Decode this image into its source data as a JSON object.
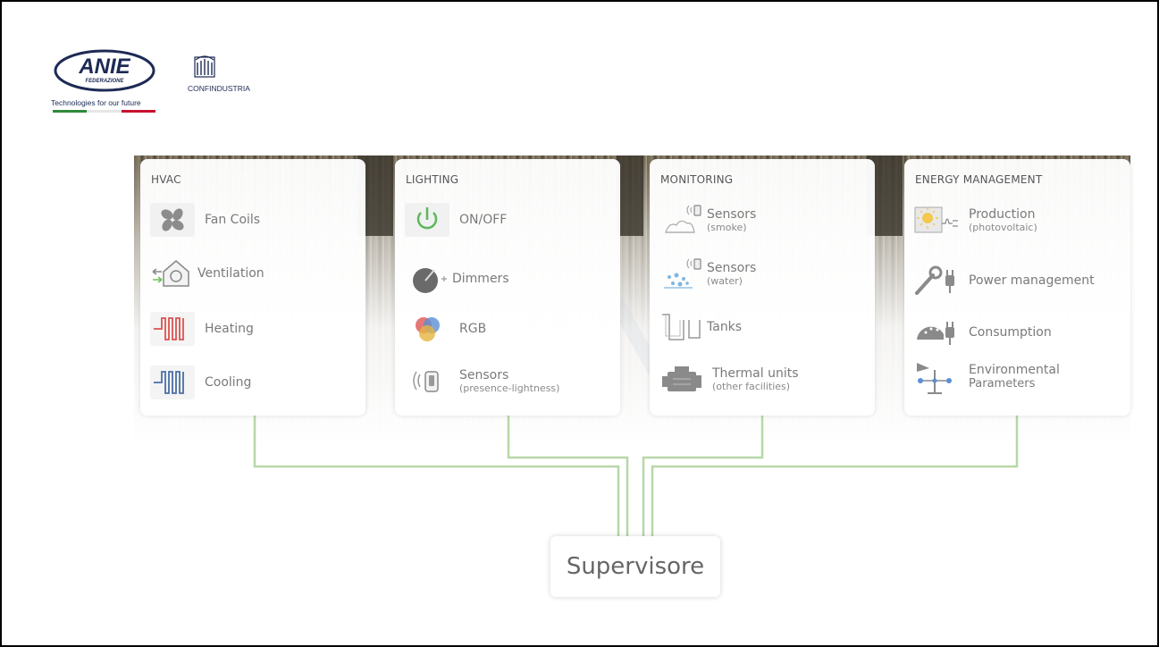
{
  "brand": {
    "anie_logo_text": "ANIE",
    "anie_logo_subtext": "FEDERAZIONE",
    "tagline": "Technologies for our future",
    "partner": "CONFINDUSTRIA"
  },
  "cards": [
    {
      "title": "HVAC",
      "items": [
        {
          "label": "Fan Coils",
          "icon": "fan-icon"
        },
        {
          "label": "Ventilation",
          "icon": "ventilation-house-icon"
        },
        {
          "label": "Heating",
          "icon": "heating-coil-icon"
        },
        {
          "label": "Cooling",
          "icon": "cooling-coil-icon"
        }
      ]
    },
    {
      "title": "LIGHTING",
      "items": [
        {
          "label": "ON/OFF",
          "icon": "power-icon"
        },
        {
          "label": "Dimmers",
          "icon": "dimmer-knob-icon"
        },
        {
          "label": "RGB",
          "icon": "rgb-circles-icon"
        },
        {
          "label": "Sensors",
          "sub": "(presence-lightness)",
          "icon": "presence-sensor-icon"
        }
      ]
    },
    {
      "title": "MONITORING",
      "items": [
        {
          "label": "Sensors",
          "sub": "(smoke)",
          "icon": "smoke-sensor-icon"
        },
        {
          "label": "Sensors",
          "sub": "(water)",
          "icon": "water-sensor-icon"
        },
        {
          "label": "Tanks",
          "icon": "tank-icon"
        },
        {
          "label": "Thermal units",
          "sub": "(other facilities)",
          "icon": "engine-icon"
        }
      ]
    },
    {
      "title": "ENERGY MANAGEMENT",
      "items": [
        {
          "label": "Production",
          "sub": "(photovoltaic)",
          "icon": "solar-panel-icon"
        },
        {
          "label": "Power management",
          "icon": "wrench-plug-icon"
        },
        {
          "label": "Consumption",
          "icon": "meter-plug-icon"
        },
        {
          "label": "Environmental",
          "sub": "Parameters",
          "icon": "weather-station-icon"
        }
      ]
    }
  ],
  "supervisor": {
    "label": "Supervisore"
  },
  "colors": {
    "connector": "#b7d7a8",
    "title_text": "#555555",
    "item_text": "#7a7a7a",
    "anie_blue": "#1d2a55",
    "italy_green": "#2e8b3a",
    "italy_red": "#c8102e"
  }
}
